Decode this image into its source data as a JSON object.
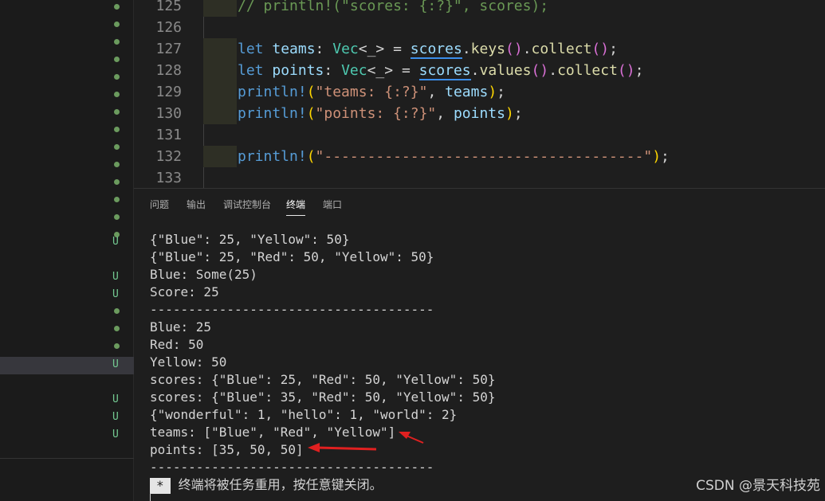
{
  "explorer": {
    "git_badge": "U"
  },
  "editor": {
    "lines": [
      {
        "num": "125",
        "comment": "// println!(\"scores: {:?}\", scores);"
      },
      {
        "num": "126"
      },
      {
        "num": "127",
        "let": "let",
        "name": "teams",
        "colon": ": ",
        "type": "Vec",
        "generic": "<_>",
        "eq": " = ",
        "recv": "scores",
        "dot1": ".",
        "method": "keys",
        "call1": "()",
        "dot2": ".",
        "collect": "collect",
        "call2": "()",
        "semi": ";"
      },
      {
        "num": "128",
        "let": "let",
        "name": "points",
        "colon": ": ",
        "type": "Vec",
        "generic": "<_>",
        "eq": " = ",
        "recv": "scores",
        "dot1": ".",
        "method": "values",
        "call1": "()",
        "dot2": ".",
        "collect": "collect",
        "call2": "()",
        "semi": ";"
      },
      {
        "num": "129",
        "macro": "println!",
        "open": "(",
        "str": "\"teams: {:?}\"",
        "comma": ", ",
        "arg": "teams",
        "close": ")",
        "semi": ";"
      },
      {
        "num": "130",
        "macro": "println!",
        "open": "(",
        "str": "\"points: {:?}\"",
        "comma": ", ",
        "arg": "points",
        "close": ")",
        "semi": ";"
      },
      {
        "num": "131"
      },
      {
        "num": "132",
        "macro": "println!",
        "open": "(",
        "str": "\"-------------------------------------\"",
        "close": ")",
        "semi": ";"
      },
      {
        "num": "133"
      }
    ]
  },
  "panel": {
    "tabs": [
      "问题",
      "输出",
      "调试控制台",
      "终端",
      "端口"
    ],
    "active_tab": "终端"
  },
  "terminal": {
    "lines": [
      "{\"Blue\": 25, \"Yellow\": 50}",
      "{\"Blue\": 25, \"Red\": 50, \"Yellow\": 50}",
      "Blue: Some(25)",
      "Score: 25",
      "-------------------------------------",
      "Blue: 25",
      "Red: 50",
      "Yellow: 50",
      "scores: {\"Blue\": 25, \"Red\": 50, \"Yellow\": 50}",
      "scores: {\"Blue\": 35, \"Red\": 50, \"Yellow\": 50}",
      "{\"wonderful\": 1, \"hello\": 1, \"world\": 2}",
      "teams: [\"Blue\", \"Red\", \"Yellow\"]",
      "points: [35, 50, 50]",
      "-------------------------------------"
    ],
    "reuse_marker": "*",
    "reuse_message": "终端将被任务重用，按任意键关闭。"
  },
  "watermark": "CSDN @景天科技苑",
  "colors": {
    "annotation_arrow": "#e02020",
    "git_untracked": "#73c991",
    "active_row": "#37373d"
  }
}
